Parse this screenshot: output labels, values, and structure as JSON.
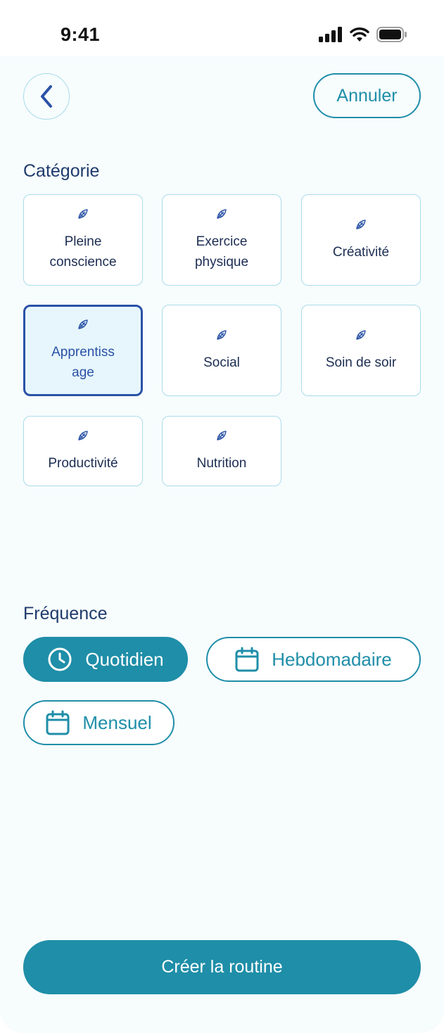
{
  "status_bar": {
    "time": "9:41"
  },
  "header": {
    "cancel_label": "Annuler"
  },
  "category": {
    "title": "Catégorie",
    "items": [
      {
        "label": "Pleine conscience",
        "selected": false
      },
      {
        "label": "Exercice physique",
        "selected": false
      },
      {
        "label": "Créativité",
        "selected": false
      },
      {
        "label": "Apprentiss age",
        "selected": true
      },
      {
        "label": "Social",
        "selected": false
      },
      {
        "label": "Soin de soir",
        "selected": false
      },
      {
        "label": "Productivité",
        "selected": false
      },
      {
        "label": "Nutrition",
        "selected": false
      }
    ]
  },
  "frequency": {
    "title": "Fréquence",
    "options": [
      {
        "label": "Quotidien",
        "icon": "clock-icon",
        "active": true
      },
      {
        "label": "Hebdomadaire",
        "icon": "calendar-icon",
        "active": false
      },
      {
        "label": "Mensuel",
        "icon": "calendar-icon",
        "active": false
      }
    ]
  },
  "cta": {
    "label": "Créer la routine"
  },
  "colors": {
    "accent": "#1f8ea8",
    "selected_border": "#2a52a6",
    "card_border": "#a9dcea",
    "heading": "#1f3b6b"
  }
}
